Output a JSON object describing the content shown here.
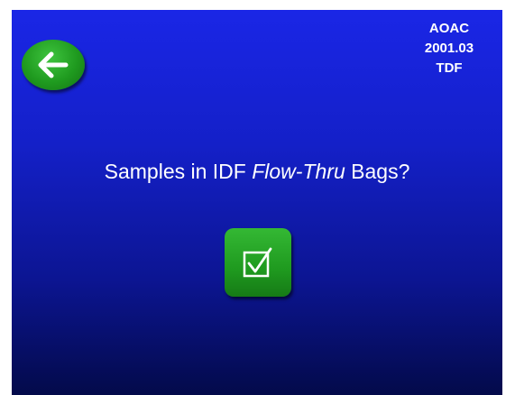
{
  "header": {
    "method_line1": "AOAC",
    "method_line2": "2001.03",
    "method_line3": "TDF"
  },
  "navigation": {
    "back_icon": "arrow-left-icon"
  },
  "prompt": {
    "text_before": "Samples in IDF ",
    "text_italic": "Flow-Thru",
    "text_after": " Bags?"
  },
  "actions": {
    "confirm_icon": "checkbox-checked-icon"
  },
  "colors": {
    "background_top": "#1a26e6",
    "background_bottom": "#030a4a",
    "button_green": "#1f9a1f",
    "text": "#ffffff"
  }
}
